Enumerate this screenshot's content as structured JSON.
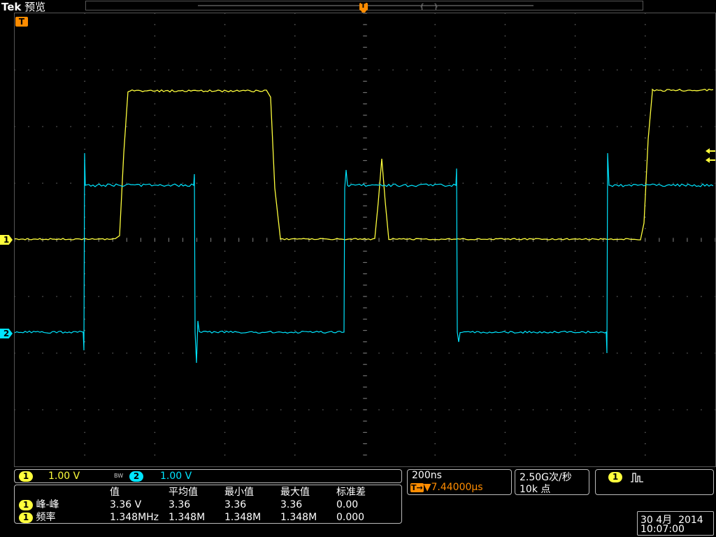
{
  "header": {
    "brand": "Tek",
    "mode": "预览"
  },
  "markers": {
    "trigger": "T",
    "ch1": "1",
    "ch2": "2"
  },
  "channels": [
    {
      "id": "1",
      "scale": "1.00 V",
      "color": "#ffff3c"
    },
    {
      "id": "2",
      "scale": "1.00 V",
      "color": "#00e5ff"
    }
  ],
  "bw_label": "BW",
  "timebase": {
    "per_div": "200ns",
    "trigger_pos": "▼7.44000µs",
    "trigger_prefix": "T→"
  },
  "acquisition": {
    "rate": "2.50G次/秒",
    "points": "10k 点"
  },
  "trigger": {
    "source": "1",
    "type_icon": "rising-edge-icon"
  },
  "measurements": {
    "headers": [
      "值",
      "平均值",
      "最小值",
      "最大值",
      "标准差"
    ],
    "rows": [
      {
        "ch": "1",
        "name": "峰-峰",
        "values": [
          "3.36 V",
          "3.36",
          "3.36",
          "3.36",
          "0.00"
        ]
      },
      {
        "ch": "1",
        "name": "频率",
        "values": [
          "1.348MHz",
          "1.348M",
          "1.348M",
          "1.348M",
          "0.000"
        ]
      }
    ]
  },
  "datetime": {
    "date": "30 4月  2014",
    "time": "10:07:00"
  },
  "colors": {
    "ch1": "#ffff3c",
    "ch2": "#00e5ff",
    "trigger": "#ff8c00"
  }
}
